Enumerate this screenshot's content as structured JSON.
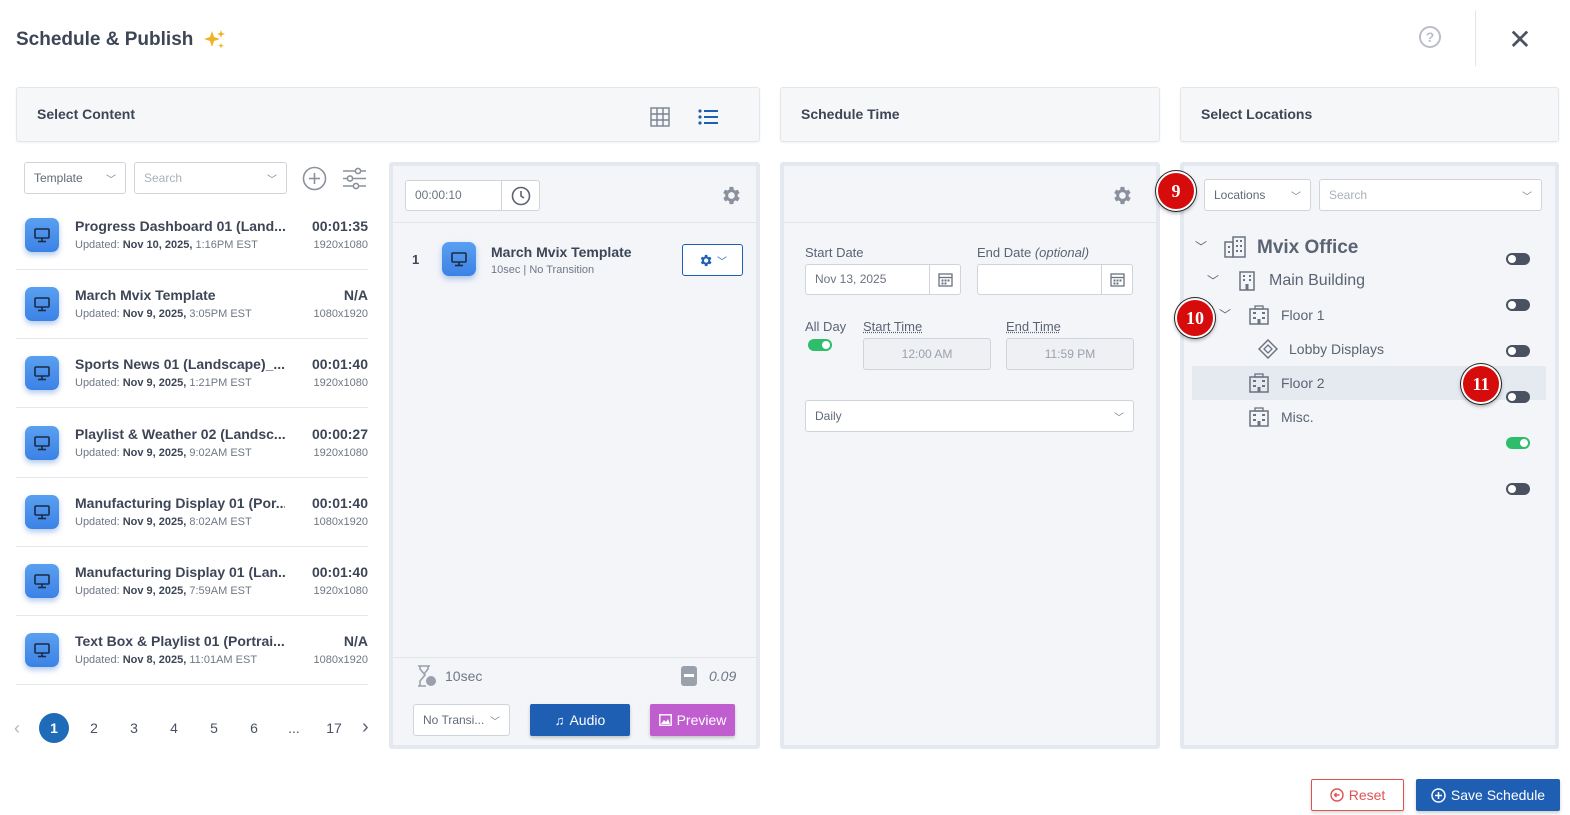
{
  "header": {
    "title": "Schedule & Publish",
    "help": "?",
    "close": "✕"
  },
  "sections": {
    "content": "Select Content",
    "time": "Schedule Time",
    "locations": "Select Locations"
  },
  "content_filters": {
    "type": "Template",
    "search_placeholder": "Search"
  },
  "content_items": [
    {
      "name": "Progress Dashboard 01 (Land...",
      "updated_label": "Updated:",
      "date": "Nov 10, 2025,",
      "time": "1:16PM EST",
      "duration": "00:01:35",
      "resolution": "1920x1080"
    },
    {
      "name": "March Mvix Template",
      "updated_label": "Updated:",
      "date": "Nov 9, 2025,",
      "time": "3:05PM EST",
      "duration": "N/A",
      "resolution": "1080x1920"
    },
    {
      "name": "Sports News 01 (Landscape)_...",
      "updated_label": "Updated:",
      "date": "Nov 9, 2025,",
      "time": "1:21PM EST",
      "duration": "00:01:40",
      "resolution": "1920x1080"
    },
    {
      "name": "Playlist & Weather 02 (Landsc...",
      "updated_label": "Updated:",
      "date": "Nov 9, 2025,",
      "time": "9:02AM EST",
      "duration": "00:00:27",
      "resolution": "1920x1080"
    },
    {
      "name": "Manufacturing Display 01 (Por...",
      "updated_label": "Updated:",
      "date": "Nov 9, 2025,",
      "time": "8:02AM EST",
      "duration": "00:01:40",
      "resolution": "1080x1920"
    },
    {
      "name": "Manufacturing Display 01 (Lan...",
      "updated_label": "Updated:",
      "date": "Nov 9, 2025,",
      "time": "7:59AM EST",
      "duration": "00:01:40",
      "resolution": "1920x1080"
    },
    {
      "name": "Text Box & Playlist 01 (Portrai...",
      "updated_label": "Updated:",
      "date": "Nov 8, 2025,",
      "time": "11:01AM EST",
      "duration": "N/A",
      "resolution": "1080x1920"
    }
  ],
  "pagination": {
    "pages": [
      "1",
      "2",
      "3",
      "4",
      "5",
      "6",
      "...",
      "17"
    ],
    "current": "1"
  },
  "playlist": {
    "duration_input": "00:00:10",
    "item": {
      "index": "1",
      "name": "March Mvix Template",
      "meta": "10sec | No Transition"
    },
    "total_duration": "10sec",
    "size": "0.09",
    "transition": "No Transi...",
    "audio_label": "Audio",
    "preview_label": "Preview"
  },
  "schedule": {
    "start_date_label": "Start Date",
    "end_date_label": "End Date",
    "end_date_optional": "(optional)",
    "start_date": "Nov 13, 2025",
    "all_day_label": "All Day",
    "start_time_label": "Start Time",
    "end_time_label": "End Time",
    "start_time": "12:00 AM",
    "end_time": "11:59 PM",
    "recurrence": "Daily"
  },
  "locations": {
    "filter": "Locations",
    "search_placeholder": "Search",
    "tree": [
      {
        "label": "Mvix Office",
        "on": false
      },
      {
        "label": "Main Building",
        "on": false
      },
      {
        "label": "Floor 1",
        "on": false
      },
      {
        "label": "Lobby Displays",
        "on": false
      },
      {
        "label": "Floor 2",
        "on": true
      },
      {
        "label": "Misc.",
        "on": false
      }
    ]
  },
  "badges": [
    "9",
    "10",
    "11"
  ],
  "footer": {
    "reset": "Reset",
    "save": "Save Schedule"
  },
  "colors": {
    "primary": "#1e5fb4",
    "preview": "#c05ed0",
    "toggle_on": "#2ebd6b",
    "badge": "#d60b0b"
  }
}
